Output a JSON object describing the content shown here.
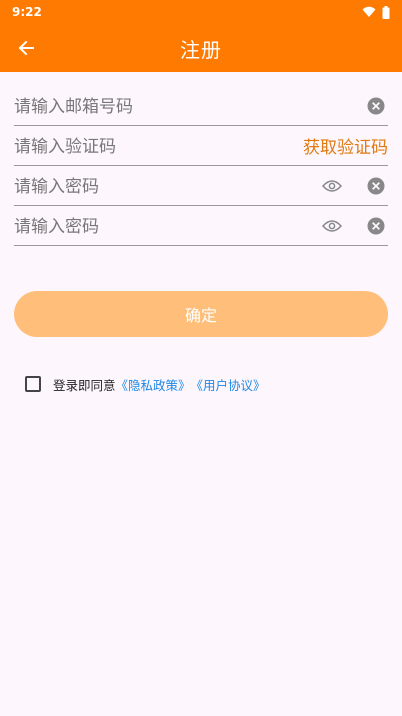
{
  "status_bar": {
    "time": "9:22"
  },
  "app_bar": {
    "title": "注册"
  },
  "form": {
    "email_placeholder": "请输入邮箱号码",
    "code_placeholder": "请输入验证码",
    "get_code_label": "获取验证码",
    "password_placeholder": "请输入密码",
    "confirm_password_placeholder": "请输入密码"
  },
  "submit_label": "确定",
  "agreement": {
    "prefix": "登录即同意",
    "privacy_link": "《隐私政策》",
    "terms_link": "《用户协议》"
  },
  "colors": {
    "primary": "#ff7a00",
    "button_disabled": "#ffbf7a",
    "link": "#1e88e5",
    "code_text": "#e07a10"
  }
}
